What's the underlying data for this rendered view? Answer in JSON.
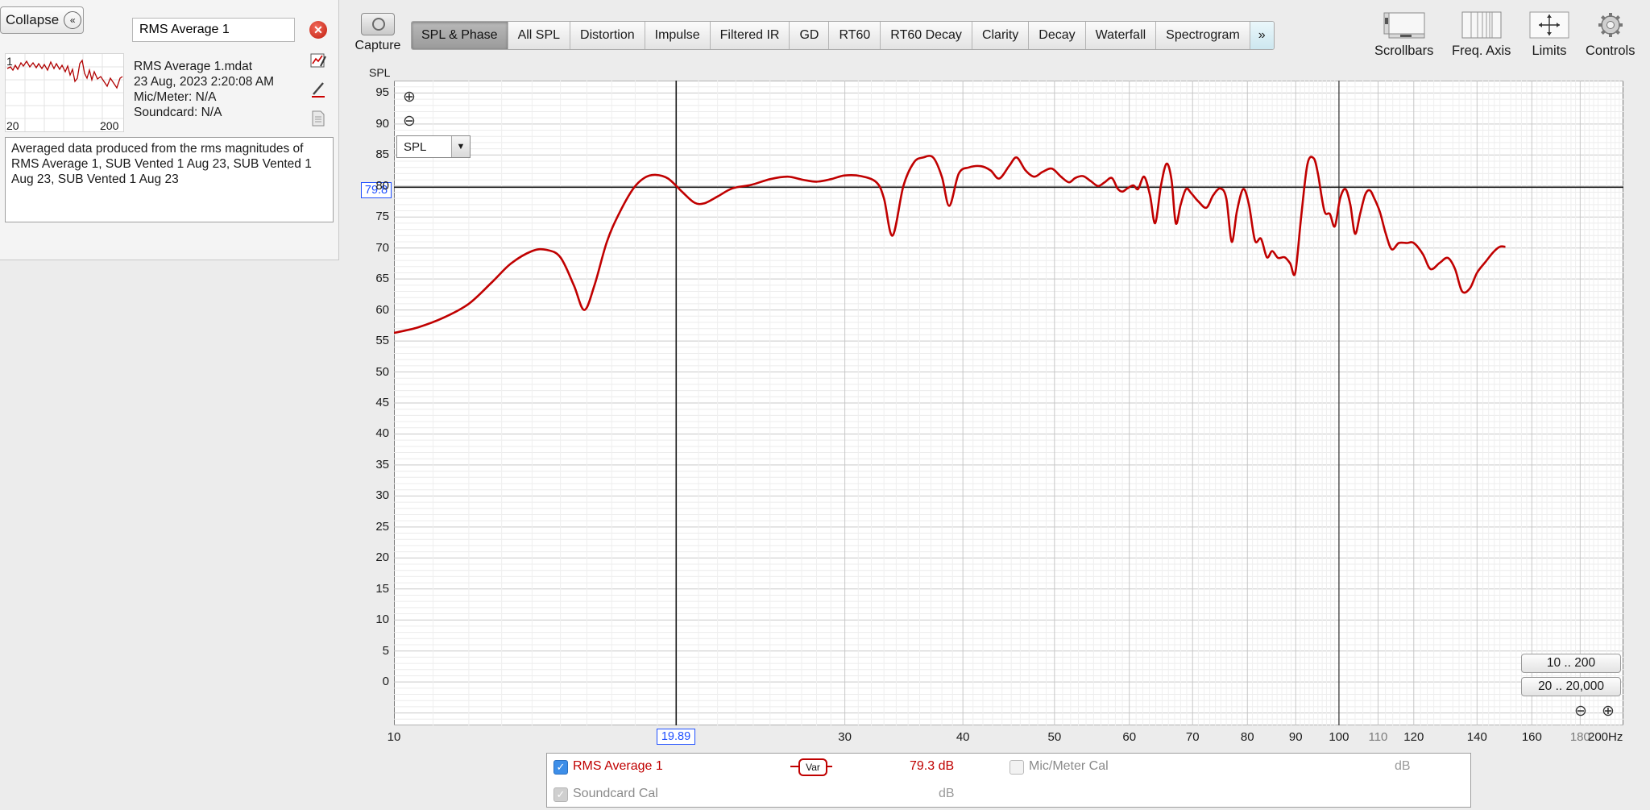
{
  "panel": {
    "collapse_label": "Collapse",
    "collapse_glyph": "«",
    "measurement_name": "RMS Average 1",
    "close_glyph": "✕",
    "thumb_index": "1",
    "thumb_x_lo": "20",
    "thumb_x_hi": "200",
    "file": "RMS Average 1.mdat",
    "date": "23 Aug, 2023 2:20:08 AM",
    "mic": "Mic/Meter: N/A",
    "soundcard": "Soundcard: N/A",
    "notes": "Averaged data produced from the rms magnitudes of RMS Average 1, SUB Vented 1 Aug 23, SUB Vented 1 Aug 23, SUB Vented 1 Aug 23",
    "icons": [
      "chart-edit-icon",
      "pen-icon",
      "document-icon"
    ]
  },
  "toolbar": {
    "capture_label": "Capture",
    "tabs": [
      "SPL & Phase",
      "All SPL",
      "Distortion",
      "Impulse",
      "Filtered IR",
      "GD",
      "RT60",
      "RT60 Decay",
      "Clarity",
      "Decay",
      "Waterfall",
      "Spectrogram"
    ],
    "active_tab": "SPL & Phase",
    "more_glyph": "»",
    "right": {
      "scrollbars": "Scrollbars",
      "freq_axis": "Freq. Axis",
      "limits": "Limits",
      "controls": "Controls"
    }
  },
  "chart": {
    "unit_label": "SPL",
    "select_value": "SPL",
    "zoom_in_glyph": "⊕",
    "zoom_out_glyph": "⊖",
    "y_cursor": "79.8",
    "x_cursor": "19.89",
    "range_btn_1": "10 .. 200",
    "range_btn_2": "20 .. 20,000"
  },
  "chart_data": {
    "type": "line",
    "x_scale": "log",
    "xlim": [
      10,
      200
    ],
    "ylim": [
      -7,
      97
    ],
    "ylabel": "SPL",
    "y_ticks": [
      0,
      5,
      10,
      15,
      20,
      25,
      30,
      35,
      40,
      45,
      50,
      55,
      60,
      65,
      70,
      75,
      80,
      85,
      90,
      95
    ],
    "x_ticks": [
      {
        "v": 10,
        "label": "10"
      },
      {
        "v": 19.89,
        "label": ""
      },
      {
        "v": 30,
        "label": "30"
      },
      {
        "v": 40,
        "label": "40"
      },
      {
        "v": 50,
        "label": "50"
      },
      {
        "v": 60,
        "label": "60"
      },
      {
        "v": 70,
        "label": "70"
      },
      {
        "v": 80,
        "label": "80"
      },
      {
        "v": 90,
        "label": "90"
      },
      {
        "v": 100,
        "label": "100"
      },
      {
        "v": 110,
        "label": "110"
      },
      {
        "v": 120,
        "label": "120"
      },
      {
        "v": 140,
        "label": "140"
      },
      {
        "v": 160,
        "label": "160"
      },
      {
        "v": 180,
        "label": "180"
      },
      {
        "v": 200,
        "label": "200Hz"
      }
    ],
    "cursor": {
      "x": 19.89,
      "y": 79.8
    },
    "series": [
      {
        "color": "#c00000",
        "points": [
          [
            10,
            56.3
          ],
          [
            10.6,
            57.2
          ],
          [
            11.3,
            58.8
          ],
          [
            12,
            61
          ],
          [
            12.7,
            64.5
          ],
          [
            13.3,
            67.5
          ],
          [
            14,
            69.5
          ],
          [
            14.5,
            69.7
          ],
          [
            15,
            68.5
          ],
          [
            15.5,
            64
          ],
          [
            15.9,
            60
          ],
          [
            16.3,
            64
          ],
          [
            16.8,
            71
          ],
          [
            17.3,
            75.5
          ],
          [
            17.9,
            79.5
          ],
          [
            18.4,
            81.3
          ],
          [
            18.9,
            81.8
          ],
          [
            19.5,
            81.2
          ],
          [
            20.2,
            79
          ],
          [
            20.8,
            77.3
          ],
          [
            21.3,
            77.2
          ],
          [
            22,
            78.3
          ],
          [
            22.8,
            79.6
          ],
          [
            23.9,
            80.2
          ],
          [
            25,
            81.1
          ],
          [
            26.1,
            81.5
          ],
          [
            27.1,
            81
          ],
          [
            28,
            80.7
          ],
          [
            29,
            81.1
          ],
          [
            30,
            81.7
          ],
          [
            31.2,
            81.6
          ],
          [
            32.4,
            80.6
          ],
          [
            33,
            78
          ],
          [
            33.7,
            72
          ],
          [
            34.6,
            80
          ],
          [
            35.5,
            83.8
          ],
          [
            36.3,
            84.6
          ],
          [
            37.2,
            84.6
          ],
          [
            38,
            81.5
          ],
          [
            38.7,
            76.8
          ],
          [
            39.6,
            82
          ],
          [
            40.6,
            83
          ],
          [
            41.8,
            83.2
          ],
          [
            42.8,
            82.5
          ],
          [
            43.7,
            81.2
          ],
          [
            44.8,
            83.3
          ],
          [
            45.6,
            84.6
          ],
          [
            46.6,
            82.5
          ],
          [
            47.6,
            81.5
          ],
          [
            48.6,
            82.3
          ],
          [
            49.7,
            82.8
          ],
          [
            50.8,
            81.5
          ],
          [
            51.8,
            80.6
          ],
          [
            52.6,
            81.3
          ],
          [
            53.6,
            81.6
          ],
          [
            54.6,
            80.8
          ],
          [
            55.6,
            80
          ],
          [
            56.5,
            80.6
          ],
          [
            57.5,
            81.3
          ],
          [
            58.3,
            79.6
          ],
          [
            59,
            79.1
          ],
          [
            59.7,
            79.6
          ],
          [
            60.6,
            80.1
          ],
          [
            61.3,
            79.5
          ],
          [
            62.2,
            81.5
          ],
          [
            63.1,
            78.5
          ],
          [
            63.9,
            74
          ],
          [
            64.8,
            80
          ],
          [
            65.7,
            83.6
          ],
          [
            66.5,
            81
          ],
          [
            67.2,
            74
          ],
          [
            68,
            77
          ],
          [
            68.9,
            79.5
          ],
          [
            69.8,
            78.8
          ],
          [
            71,
            77.5
          ],
          [
            72.4,
            76.5
          ],
          [
            73.6,
            78.5
          ],
          [
            74.9,
            79.6
          ],
          [
            76,
            78
          ],
          [
            77,
            71
          ],
          [
            78,
            76
          ],
          [
            79.2,
            79.5
          ],
          [
            80.3,
            77
          ],
          [
            81.5,
            71.2
          ],
          [
            82.7,
            71.5
          ],
          [
            83.9,
            68.5
          ],
          [
            85,
            69.5
          ],
          [
            86.2,
            68.4
          ],
          [
            87.6,
            68.5
          ],
          [
            88.8,
            67.5
          ],
          [
            89.9,
            66
          ],
          [
            91.2,
            75
          ],
          [
            92.6,
            83.5
          ],
          [
            94,
            84.5
          ],
          [
            95,
            82
          ],
          [
            96.5,
            76
          ],
          [
            97.8,
            75.5
          ],
          [
            99,
            73.5
          ],
          [
            100.3,
            78
          ],
          [
            101.6,
            79.5
          ],
          [
            102.8,
            77
          ],
          [
            104,
            72.3
          ],
          [
            105.3,
            75.5
          ],
          [
            106.6,
            78.6
          ],
          [
            107.8,
            79.3
          ],
          [
            109,
            78
          ],
          [
            110.5,
            75.8
          ],
          [
            112,
            72.5
          ],
          [
            113.7,
            69.8
          ],
          [
            115.7,
            70.8
          ],
          [
            118,
            70.8
          ],
          [
            120,
            70.8
          ],
          [
            122.7,
            69
          ],
          [
            125,
            66.6
          ],
          [
            127.8,
            67.6
          ],
          [
            130.4,
            68.4
          ],
          [
            132.7,
            66.6
          ],
          [
            135,
            63
          ],
          [
            137.6,
            63.5
          ],
          [
            140,
            66
          ],
          [
            143,
            67.8
          ],
          [
            145.6,
            69.3
          ],
          [
            148,
            70.2
          ],
          [
            150,
            70.2
          ]
        ]
      }
    ]
  },
  "legend": {
    "series_name": "RMS Average 1",
    "var_label": "Var",
    "value": "79.3 dB",
    "mic_cal": "Mic/Meter Cal",
    "mic_unit": "dB",
    "soundcard_cal": "Soundcard Cal",
    "sc_unit": "dB"
  }
}
